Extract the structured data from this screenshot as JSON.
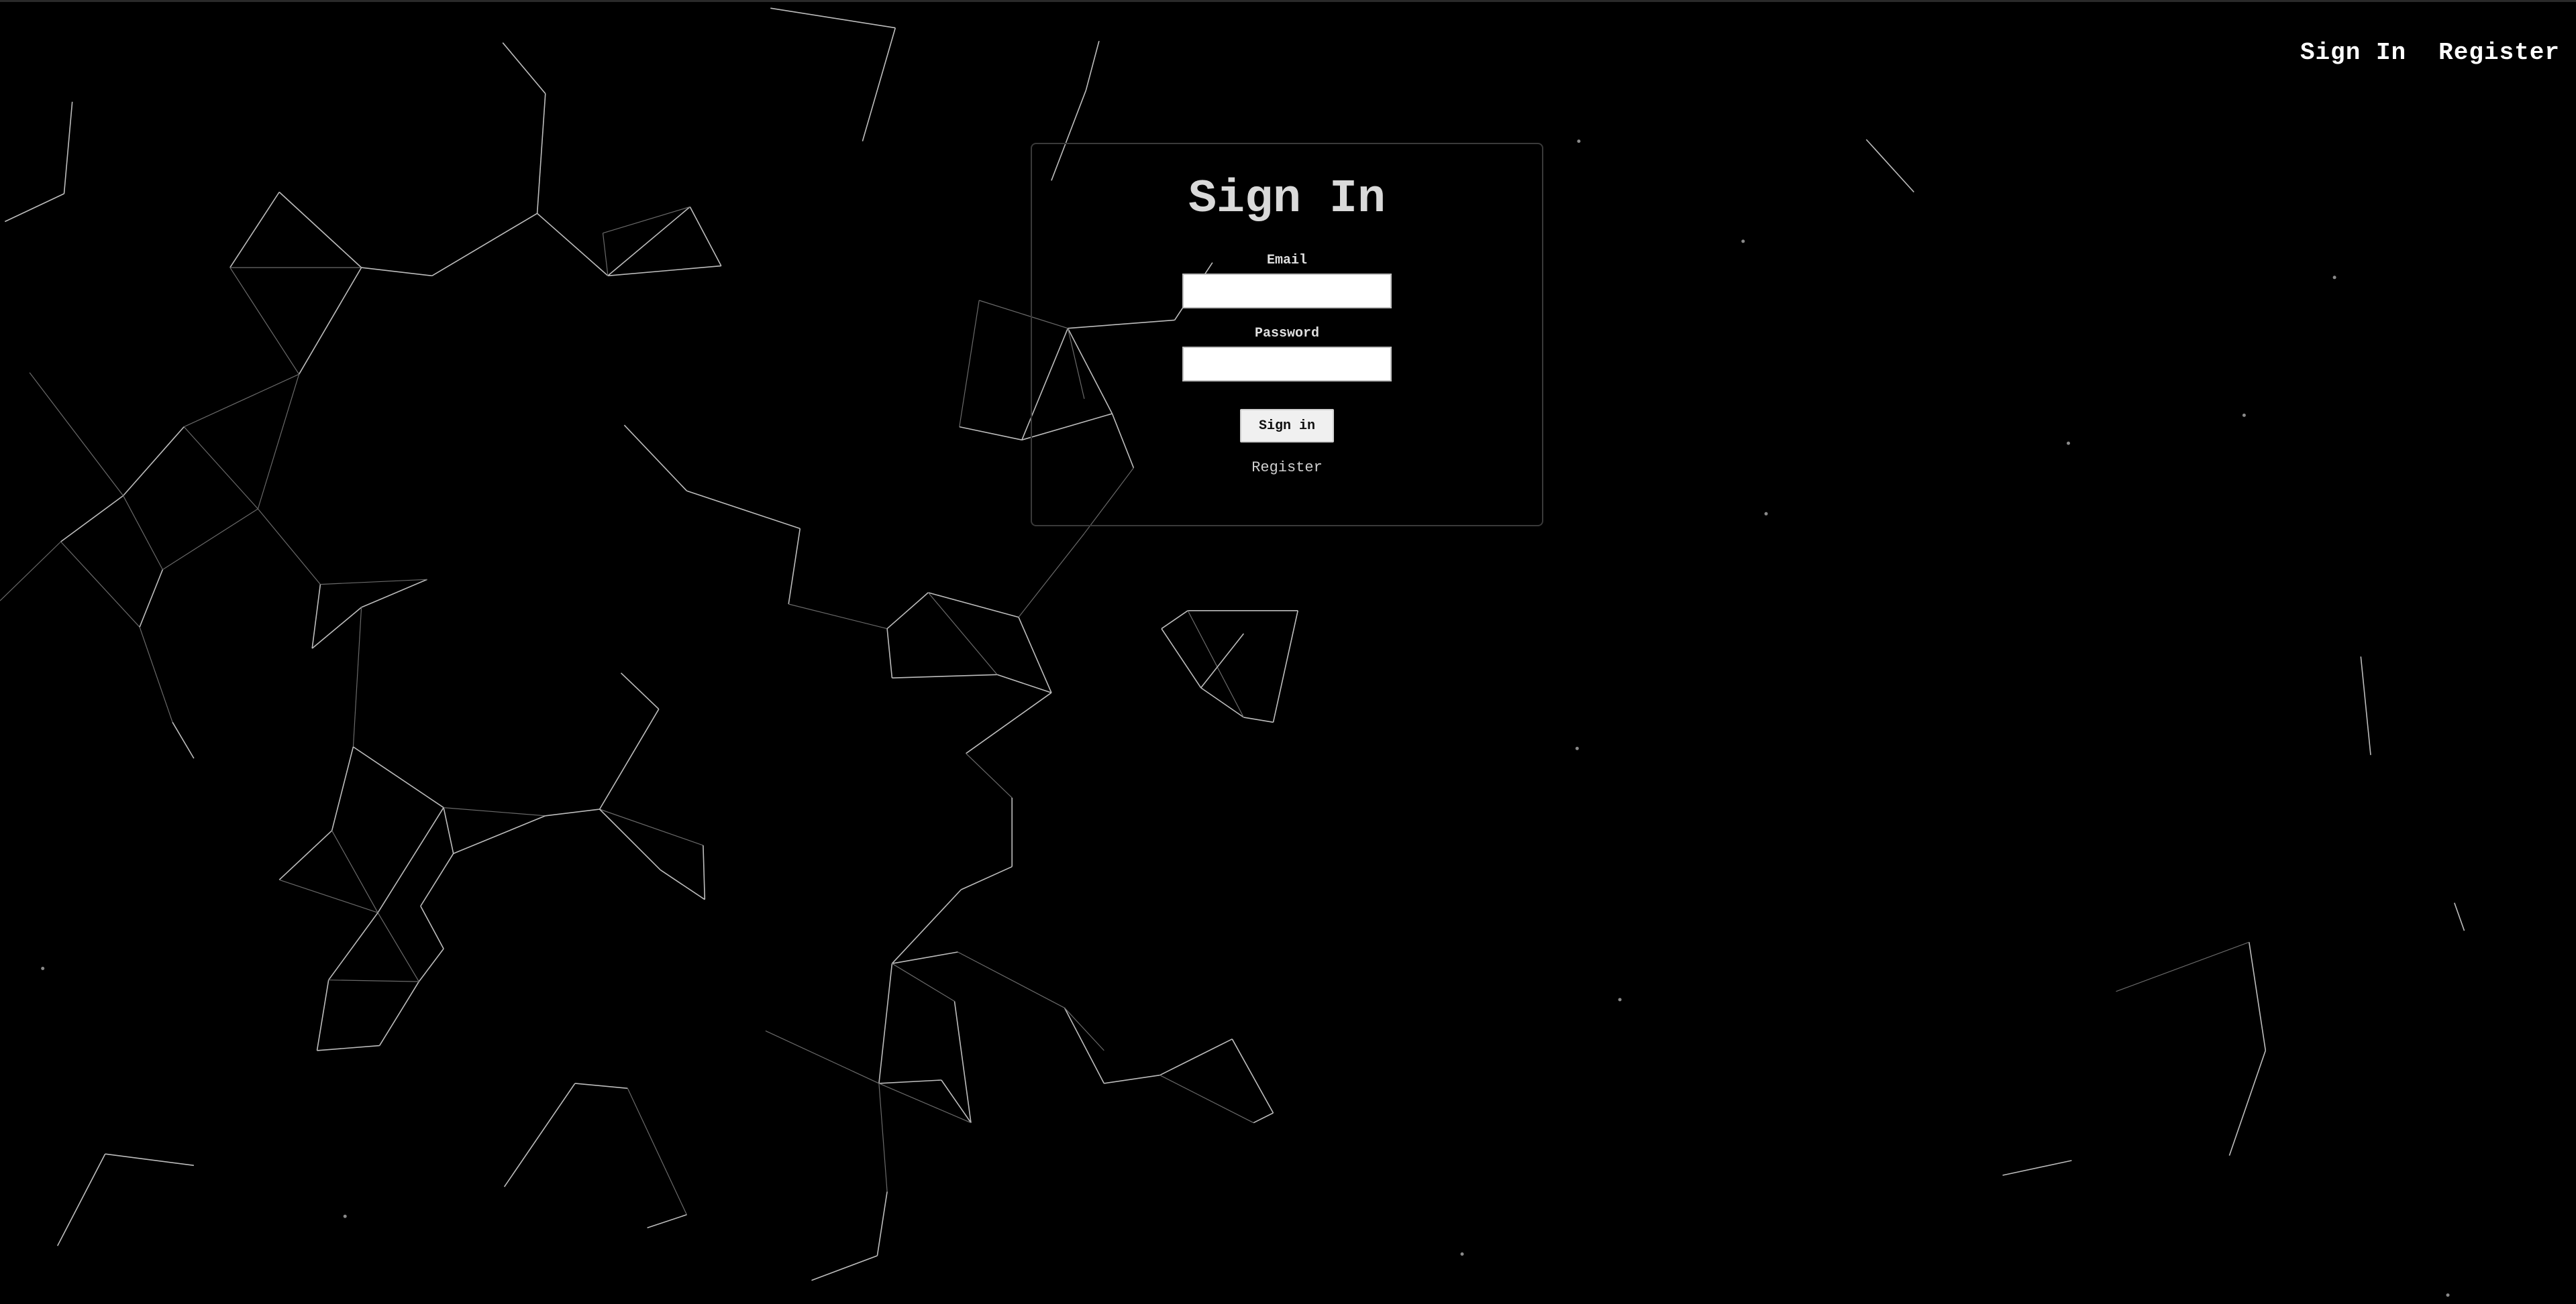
{
  "nav": {
    "sign_in_label": "Sign In",
    "register_label": "Register"
  },
  "form": {
    "title": "Sign In",
    "email_label": "Email",
    "email_value": "",
    "password_label": "Password",
    "password_value": "",
    "submit_label": "Sign in",
    "register_link_label": "Register"
  },
  "colors": {
    "background": "#000000",
    "text": "#ffffff",
    "network_lines": "#bdbdbd"
  }
}
